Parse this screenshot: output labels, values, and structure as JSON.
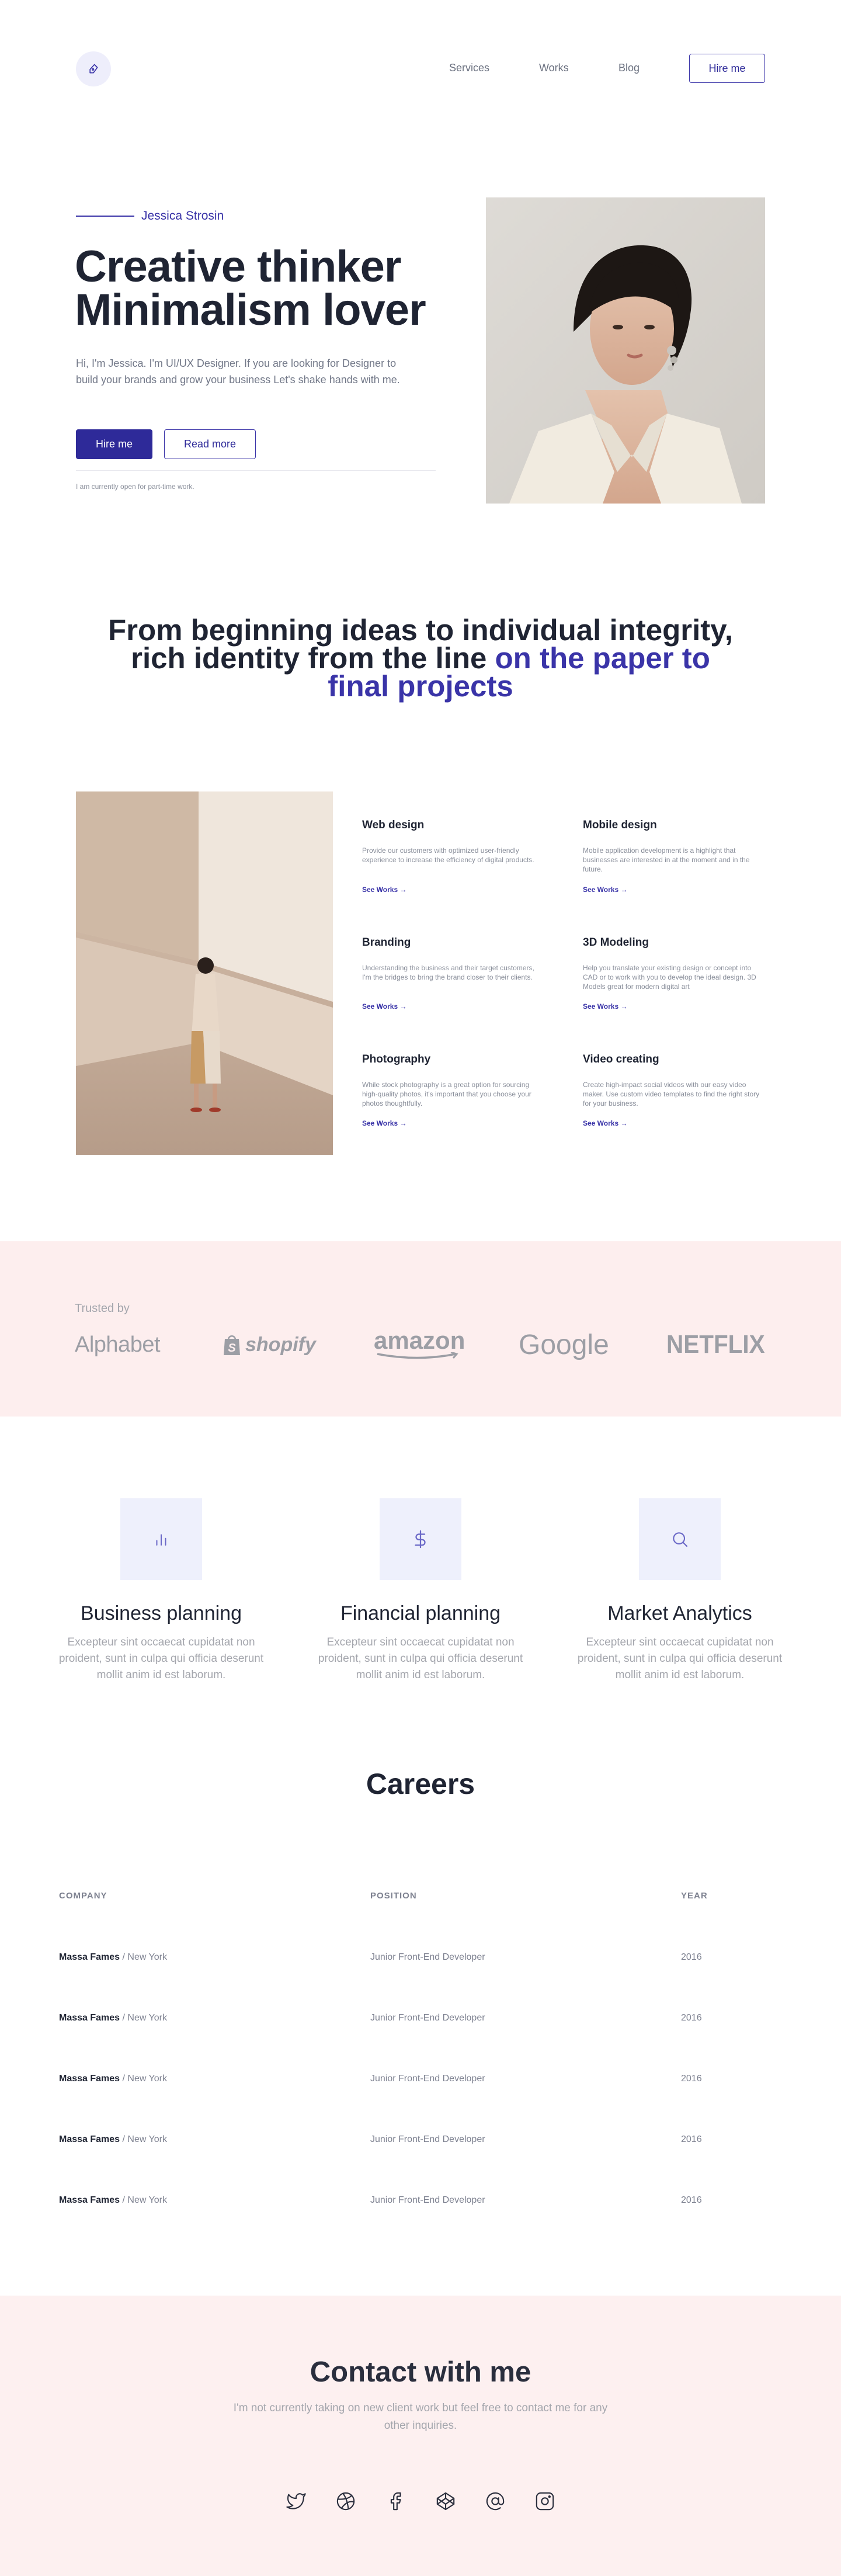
{
  "nav": {
    "links": [
      "Services",
      "Works",
      "Blog"
    ],
    "hire_label": "Hire me"
  },
  "hero": {
    "name": "Jessica Strosin",
    "title_line1": "Creative thinker",
    "title_line2": "Minimalism lover",
    "description": "Hi, I'm Jessica. I'm UI/UX Designer. If you are looking for Designer to build your brands and grow your business Let's shake hands with me.",
    "primary_button": "Hire me",
    "secondary_button": "Read more",
    "availability_note": "I am currently open for part-time work."
  },
  "statement": {
    "line1": "From beginning ideas to individual integrity,",
    "line2_plain": "rich identity from the line ",
    "line2_accent": "on the paper to",
    "line3_accent": "final projects"
  },
  "services": {
    "items": [
      {
        "title": "Web design",
        "description": "Provide our customers with optimized user-friendly experience to increase the efficiency of digital products.",
        "link": "See Works"
      },
      {
        "title": "Mobile design",
        "description": "Mobile application development is a highlight that businesses are interested in at the moment and in the future.",
        "link": "See Works"
      },
      {
        "title": "Branding",
        "description": "Understanding the business and their target customers, I'm the bridges to bring the brand closer to their clients.",
        "link": "See Works"
      },
      {
        "title": "3D Modeling",
        "description": "Help you translate your existing design or concept into CAD or to work with you to develop the ideal design. 3D Models great for modern digital art",
        "link": "See Works"
      },
      {
        "title": "Photography",
        "description": "While stock photography is a great option for sourcing high-quality photos, it's important that you choose your photos thoughtfully.",
        "link": "See Works"
      },
      {
        "title": "Video creating",
        "description": "Create high-impact social videos with our easy video maker. Use custom video templates to find the right story for your business.",
        "link": "See Works"
      }
    ]
  },
  "trusted": {
    "label": "Trusted by",
    "brands": [
      "Alphabet",
      "shopify",
      "amazon",
      "Google",
      "NETFLIX"
    ]
  },
  "features": [
    {
      "icon": "bar-chart-icon",
      "title": "Business planning",
      "description": "Excepteur sint occaecat cupidatat non proident, sunt in culpa qui officia deserunt mollit anim id est laborum."
    },
    {
      "icon": "dollar-icon",
      "title": "Financial planning",
      "description": "Excepteur sint occaecat cupidatat non proident, sunt in culpa qui officia deserunt mollit anim id est laborum."
    },
    {
      "icon": "search-icon",
      "title": "Market Analytics",
      "description": "Excepteur sint occaecat cupidatat non proident, sunt in culpa qui officia deserunt mollit anim id est laborum."
    }
  ],
  "careers": {
    "title": "Careers",
    "headers": [
      "COMPANY",
      "POSITION",
      "YEAR"
    ],
    "rows": [
      {
        "company": "Massa Fames",
        "location": " / New York",
        "position": "Junior Front-End Developer",
        "year": "2016"
      },
      {
        "company": "Massa Fames",
        "location": " / New York",
        "position": "Junior Front-End Developer",
        "year": "2016"
      },
      {
        "company": "Massa Fames",
        "location": " / New York",
        "position": "Junior Front-End Developer",
        "year": "2016"
      },
      {
        "company": "Massa Fames",
        "location": " / New York",
        "position": "Junior Front-End Developer",
        "year": "2016"
      },
      {
        "company": "Massa Fames",
        "location": " / New York",
        "position": "Junior Front-End Developer",
        "year": "2016"
      }
    ]
  },
  "contact": {
    "title": "Contact with me",
    "description": "I'm not currently taking on new client work but feel free to contact me for any other inquiries.",
    "socials": [
      "twitter-icon",
      "dribbble-icon",
      "facebook-icon",
      "codepen-icon",
      "at-icon",
      "instagram-icon"
    ]
  },
  "colors": {
    "accent": "#2e2a99",
    "trusted_band": "#fdeeee",
    "contact_band": "#fdf0f0",
    "feature_box": "#eef0fc"
  }
}
